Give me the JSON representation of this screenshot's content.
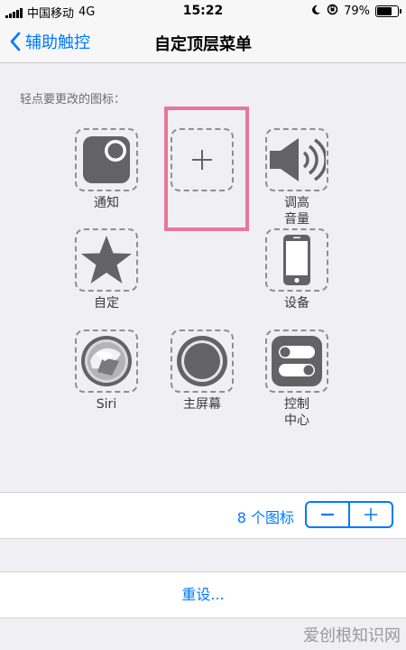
{
  "status_bar": {
    "carrier": "中国移动",
    "network": "4G",
    "time": "15:22",
    "battery_percent": "79%",
    "battery_level": 0.79
  },
  "nav": {
    "back_label": "辅助触控",
    "title": "自定顶层菜单"
  },
  "section_header": "轻点要更改的图标：",
  "icons": [
    {
      "label": "通知",
      "icon": "notification-icon"
    },
    {
      "label": "",
      "icon": "add-icon"
    },
    {
      "label": "调高\n音量",
      "icon": "volume-up-icon"
    },
    {
      "label": "自定",
      "icon": "star-icon"
    },
    {
      "label": "设备",
      "icon": "device-icon"
    },
    {
      "label": "Siri",
      "icon": "siri-icon"
    },
    {
      "label": "主屏幕",
      "icon": "home-icon"
    },
    {
      "label": "控制\n中心",
      "icon": "control-center-icon"
    }
  ],
  "icon_count": {
    "label": "8 个图标",
    "minus": "−",
    "plus": "+"
  },
  "reset_label": "重设...",
  "watermark": "爱创根知识网",
  "colors": {
    "accent": "#007aff",
    "highlight": "#e8769a",
    "icon_gray": "#636366"
  }
}
